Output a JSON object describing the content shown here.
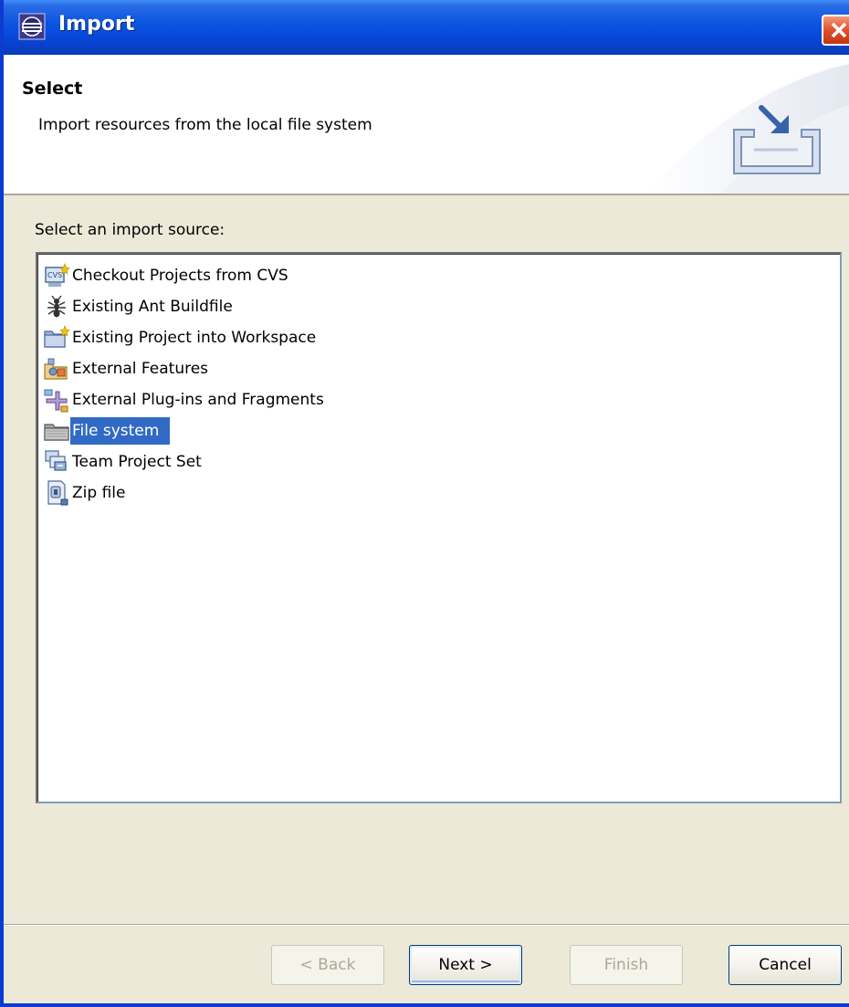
{
  "window": {
    "title": "Import",
    "title_icon": "eclipse-app-icon",
    "close_icon": "close-icon"
  },
  "banner": {
    "heading": "Select",
    "description": "Import resources from the local file system",
    "icon": "import-wizard-icon"
  },
  "content": {
    "source_label": "Select an import source:",
    "items": [
      {
        "label": "Checkout Projects from CVS",
        "icon": "cvs-checkout-icon",
        "selected": false
      },
      {
        "label": "Existing Ant Buildfile",
        "icon": "ant-icon",
        "selected": false
      },
      {
        "label": "Existing Project into Workspace",
        "icon": "project-folder-icon",
        "selected": false
      },
      {
        "label": "External Features",
        "icon": "features-icon",
        "selected": false
      },
      {
        "label": "External Plug-ins and Fragments",
        "icon": "plugins-icon",
        "selected": false
      },
      {
        "label": "File system",
        "icon": "folder-icon",
        "selected": true
      },
      {
        "label": "Team Project Set",
        "icon": "team-project-set-icon",
        "selected": false
      },
      {
        "label": "Zip file",
        "icon": "zip-file-icon",
        "selected": false
      }
    ]
  },
  "buttons": {
    "back": {
      "label": "< Back",
      "enabled": false
    },
    "next": {
      "label": "Next >",
      "enabled": true
    },
    "finish": {
      "label": "Finish",
      "enabled": false
    },
    "cancel": {
      "label": "Cancel",
      "enabled": true
    }
  },
  "colors": {
    "title_bar": "#0a53e1",
    "selection": "#316ac5",
    "dialog_background": "#ece9d8"
  }
}
